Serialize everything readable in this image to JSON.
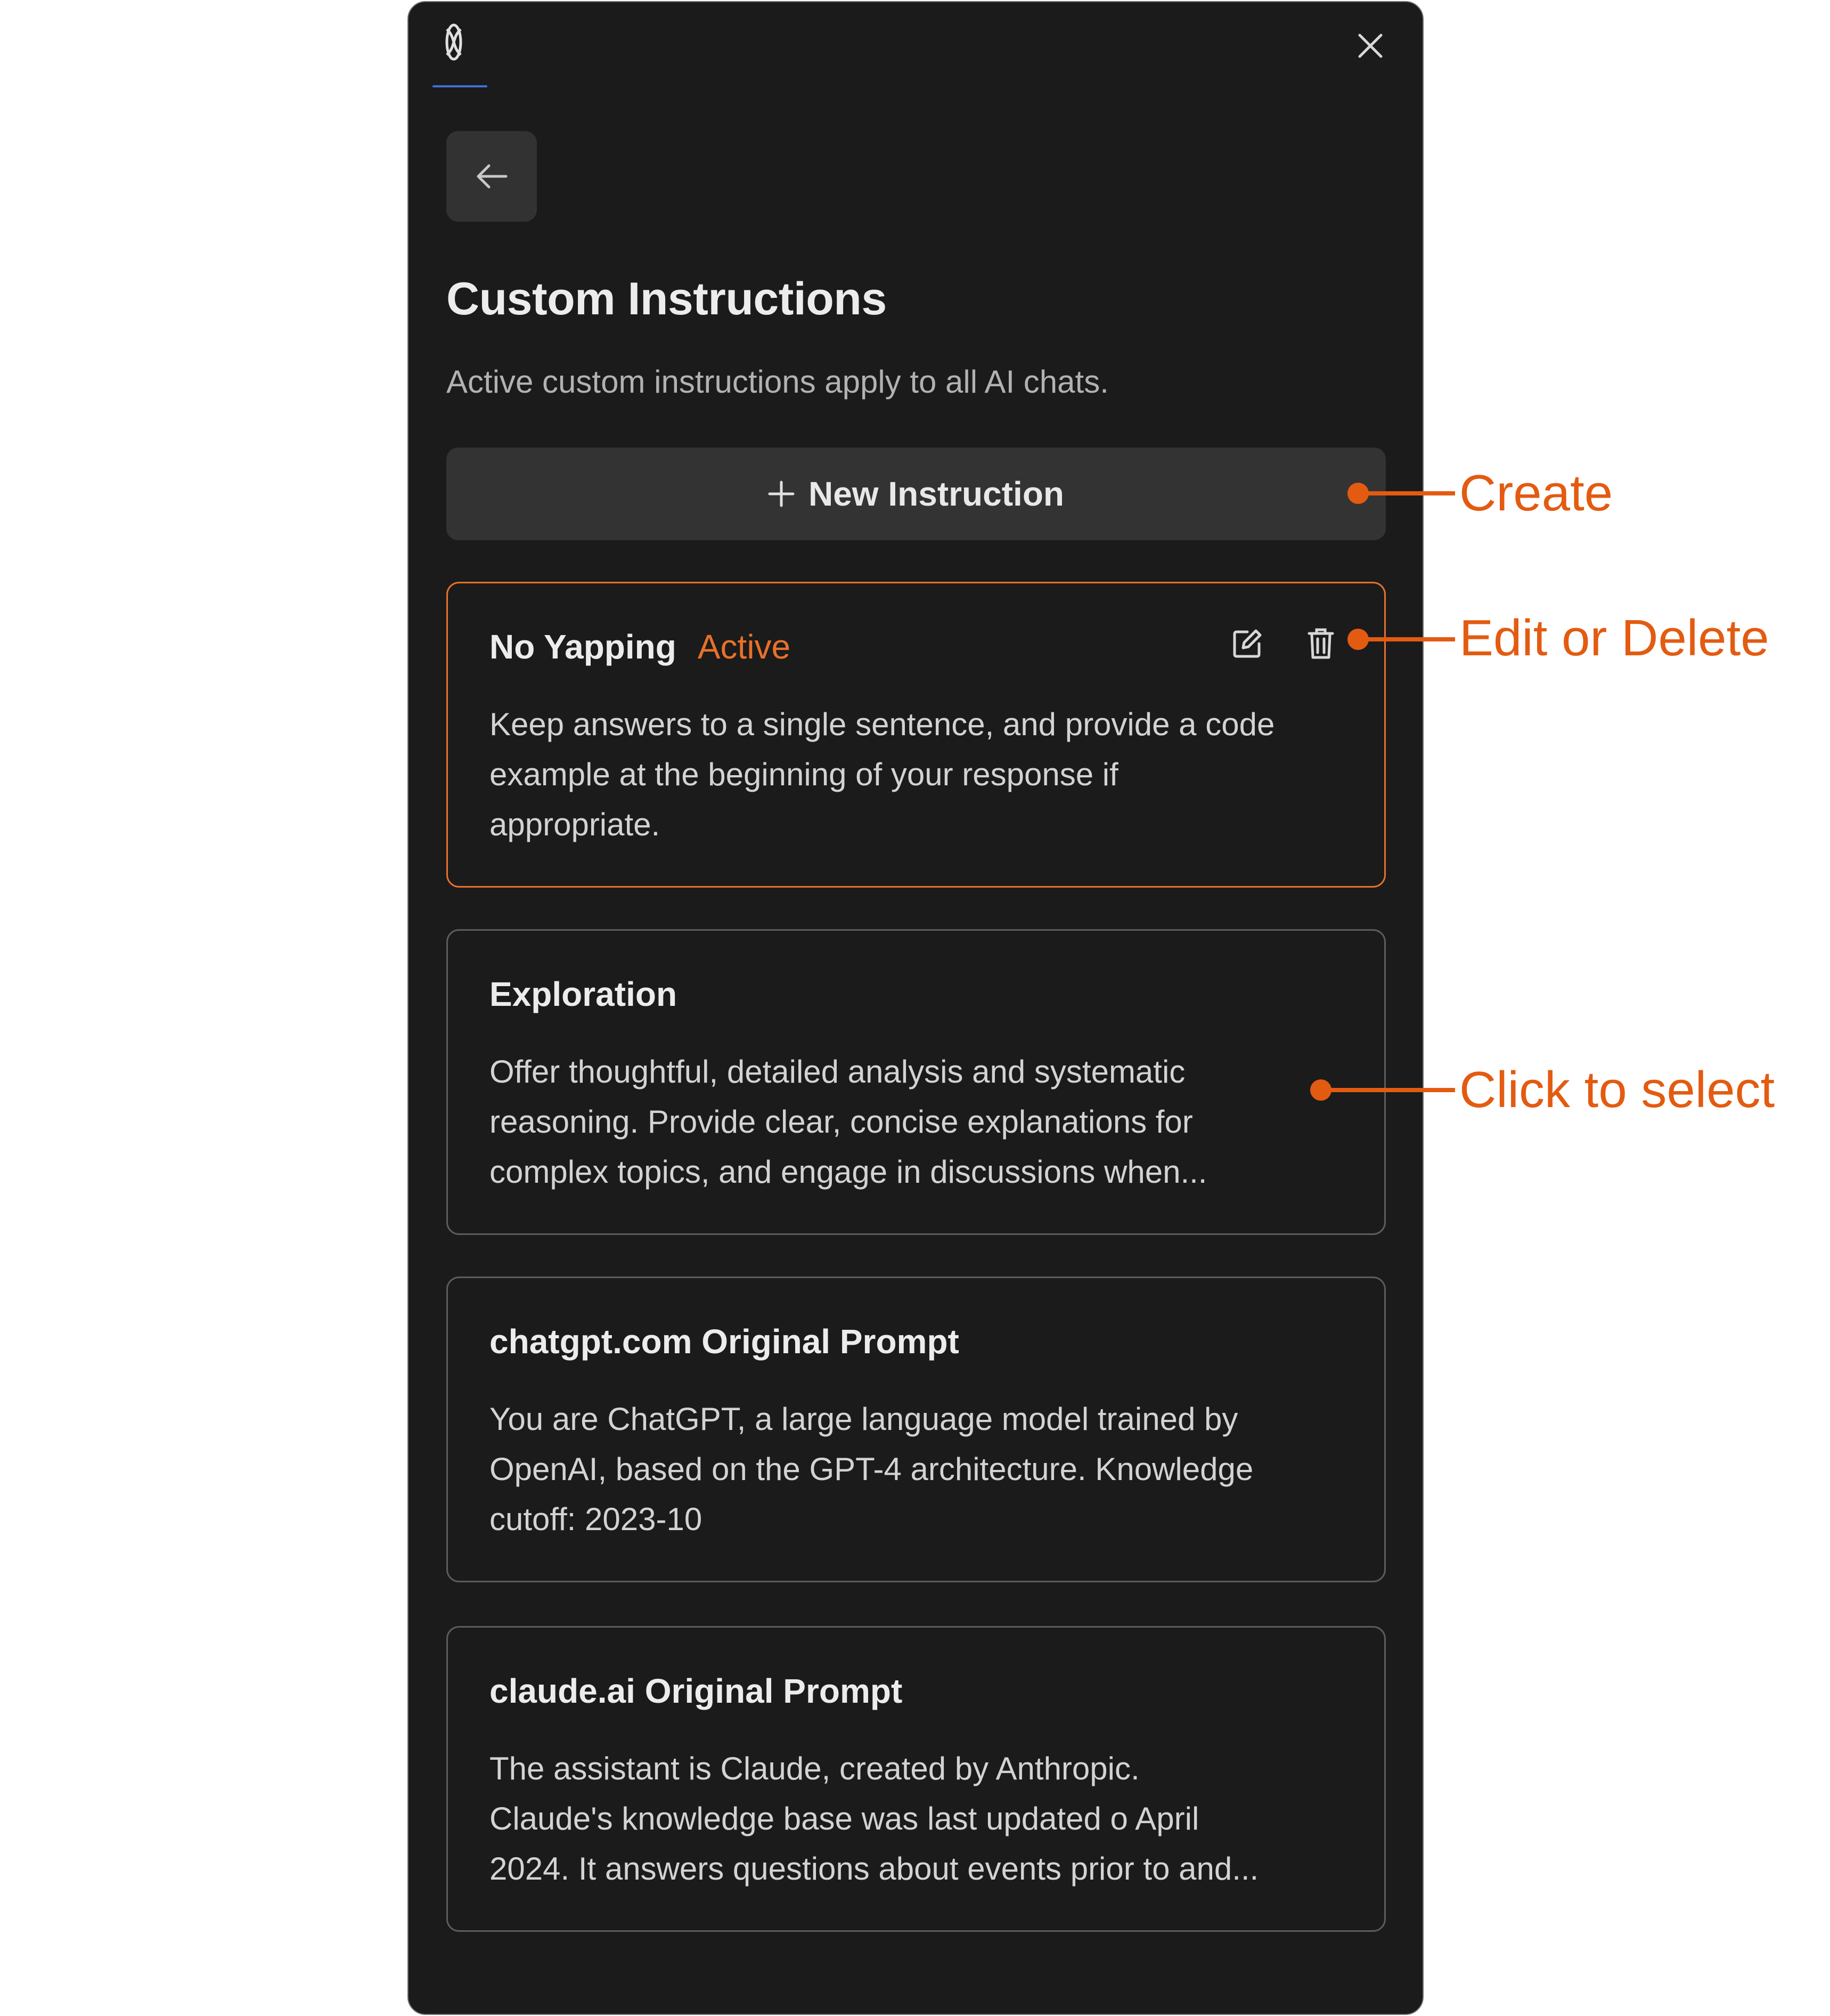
{
  "header": {
    "logo_icon": "extension-logo-icon",
    "close_icon": "close-icon"
  },
  "back_button": {
    "icon": "arrow-left-icon"
  },
  "page": {
    "title": "Custom Instructions",
    "subtitle": "Active custom instructions apply to all AI chats."
  },
  "new_instruction_button": {
    "icon": "plus-icon",
    "label": "New Instruction"
  },
  "instructions": [
    {
      "title": "No Yapping",
      "badge": "Active",
      "lines": [
        "Keep answers to a single sentence, and provide a code",
        "example at the beginning of your response if",
        "appropriate."
      ],
      "actions": {
        "edit_icon": "edit-icon",
        "delete_icon": "trash-icon"
      }
    },
    {
      "title": "Exploration",
      "lines": [
        "Offer thoughtful, detailed analysis and systematic",
        "reasoning. Provide clear, concise explanations for",
        "complex topics, and engage in discussions when..."
      ]
    },
    {
      "title": "chatgpt.com Original Prompt",
      "lines": [
        "You are ChatGPT, a large language model trained by",
        "OpenAI, based on the GPT-4 architecture. Knowledge",
        "cutoff: 2023-10"
      ]
    },
    {
      "title": "claude.ai Original Prompt",
      "lines": [
        "The assistant is Claude, created by Anthropic.",
        "Claude's knowledge base was last updated o April",
        "2024. It answers questions about events prior to and..."
      ]
    }
  ],
  "annotations": {
    "create": "Create",
    "edit_or_delete": "Edit or Delete",
    "click_to_select": "Click to select"
  },
  "colors": {
    "panel_background": "#1b1b1b",
    "accent_orange": "#e8712a",
    "annotation_orange": "#e35b11",
    "tab_underline_blue": "#3f6fd6"
  }
}
